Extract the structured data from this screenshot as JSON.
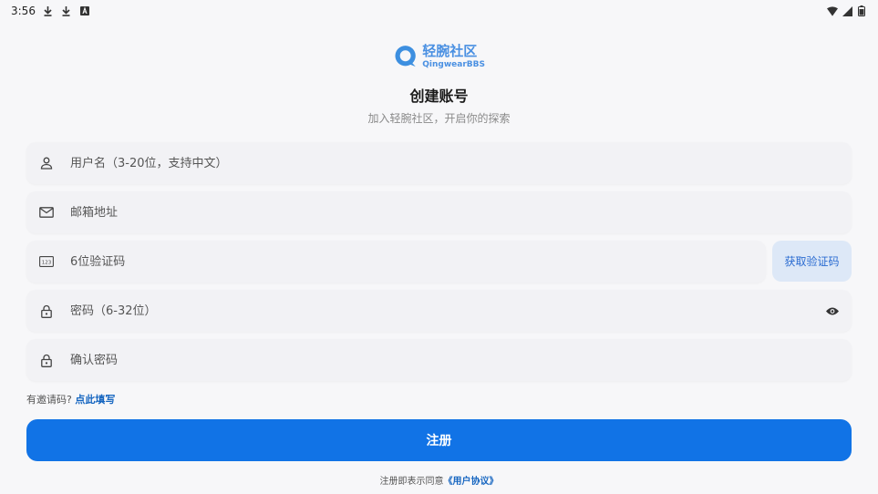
{
  "status_bar": {
    "time": "3:56",
    "left_icons": [
      "download-icon",
      "download-icon",
      "text-a-icon"
    ],
    "right_icons": [
      "wifi-icon",
      "signal-icon",
      "battery-icon"
    ]
  },
  "logo": {
    "title": "轻腕社区",
    "subtitle": "QingwearBBS"
  },
  "header": {
    "title": "创建账号",
    "subtitle": "加入轻腕社区，开启你的探索"
  },
  "form": {
    "username": {
      "placeholder": "用户名（3-20位，支持中文）",
      "value": "",
      "icon": "person-icon"
    },
    "email": {
      "placeholder": "邮箱地址",
      "value": "",
      "icon": "mail-icon"
    },
    "code": {
      "placeholder": "6位验证码",
      "value": "",
      "icon": "numeric-123-icon"
    },
    "get_code_label": "获取验证码",
    "password": {
      "placeholder": "密码（6-32位）",
      "value": "",
      "icon": "lock-icon",
      "toggle_icon": "eye-icon"
    },
    "confirm_password": {
      "placeholder": "确认密码",
      "value": "",
      "icon": "lock-icon"
    }
  },
  "invite": {
    "prompt": "有邀请码?",
    "link": "点此填写"
  },
  "register_label": "注册",
  "agreement": {
    "prefix": "注册即表示同意",
    "link": "《用户协议》"
  },
  "colors": {
    "accent": "#1173e6",
    "link": "#1565c0",
    "field_bg": "#f2f2f5",
    "code_button_bg": "#dde8f7"
  }
}
